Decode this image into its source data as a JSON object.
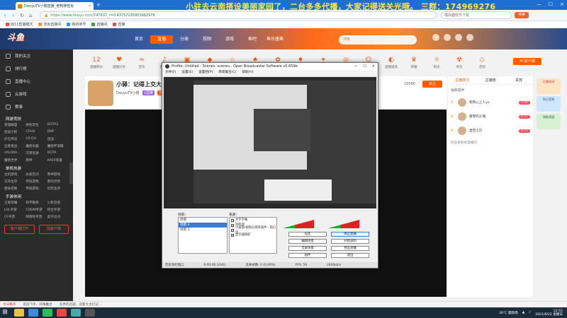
{
  "browser": {
    "tab_title": "DouyuTV小楼直播_老鸭神性玩",
    "marquee": "小驻去云南搭设美丽家园了，二台多多代播，大家记得送关光哦。  三群：174969276",
    "url_prefix": "https://www.douyu.com",
    "url_rest": "/747637_r=0.43757295803982976",
    "search_placeholder": "模拟器软件下载",
    "search_button": "搜索",
    "bookmarks": [
      "双11直播模式",
      "流出直播间",
      "我的账号",
      "直播间",
      "直播"
    ]
  },
  "site": {
    "logo": "斗鱼",
    "nav": [
      "首页",
      "直播",
      "分类",
      "视频",
      "游戏",
      "鱼吧",
      "鱼乐盛典"
    ],
    "search_placeholder": "搜索",
    "pc_client": "PC客户端"
  },
  "sidebar": {
    "items": [
      "我的关注",
      "排行榜",
      "直播中心",
      "云游戏",
      "赛事"
    ],
    "sec_hot": "网游竞技",
    "hot_games": [
      "英雄联盟",
      "绝地求生",
      "DOTA2",
      "逆战小程",
      "CFHD",
      "DNF",
      "炉石传说",
      "CS:GO",
      "逆战",
      "全民枪战",
      "魔兽争霸",
      "魔兽怀旧服",
      "VALORA...",
      "守望先锋",
      "DOTA",
      "魔兽世界",
      "原神",
      "APEX英雄"
    ],
    "sec_mobile": "单机热游",
    "mobile_games": [
      "主机游戏",
      "永劫无间",
      "原神游戏",
      "方舟生存",
      "怀旧游戏",
      "我的世界",
      "使命召唤",
      "怀旧游戏",
      "饥荒生存"
    ],
    "sec_pc": "手游休闲",
    "pc_games": [
      "王者荣耀",
      "和平精英",
      "火影忍者",
      "LOL手游",
      "CODM手游",
      "综合手游",
      "CF手游",
      "阴阳师手游",
      "蛋仔派对"
    ],
    "btn_left": "客户端打开",
    "btn_right": "找客户端"
  },
  "categories": [
    {
      "icon": "12",
      "label": "直播积分"
    },
    {
      "icon": "♥",
      "label": "直播分享"
    },
    {
      "icon": "≈",
      "label": "音乐"
    },
    {
      "icon": "♪",
      "label": "音乐台"
    },
    {
      "icon": "▣",
      "label": "直播记录"
    },
    {
      "icon": "◆",
      "label": "星光"
    },
    {
      "icon": "☆",
      "label": "星光"
    },
    {
      "icon": "♠",
      "label": "猫咪"
    },
    {
      "icon": "✿",
      "label": "鲜花"
    },
    {
      "icon": "♦",
      "label": "钻石"
    },
    {
      "icon": "✦",
      "label": "星光"
    },
    {
      "icon": "◎",
      "label": "签到"
    },
    {
      "icon": "☺",
      "label": "表情"
    },
    {
      "icon": "◐",
      "label": "直播道具"
    },
    {
      "icon": "♛",
      "label": "荣耀"
    },
    {
      "icon": "☼",
      "label": "阳光"
    },
    {
      "icon": "☢",
      "label": "背包"
    },
    {
      "icon": "◇",
      "label": "活动"
    }
  ],
  "stream": {
    "title": "小驿：记得上交大天",
    "owner": "DouyuTV小楼",
    "badge": "V国舞",
    "tag": "直播中",
    "followers": "23586",
    "follow_btn": "关注"
  },
  "right_panel": {
    "tabs": [
      "主播排行",
      "主播榜",
      "贵宾"
    ],
    "heading": "独家陪伴",
    "ranks": [
      {
        "num": "1",
        "name": "和和心上人yo",
        "level": "lv.40"
      },
      {
        "num": "2",
        "name": "飘零的斗魂",
        "level": "lv.21"
      },
      {
        "num": "3",
        "name": "虚空之刃",
        "level": "lv.15"
      }
    ],
    "join_text": "欢迎来到本直播间",
    "widgets": [
      "主播房间",
      "你已签到",
      "领取奖励"
    ]
  },
  "obs": {
    "title": "Profile: Untitled - Scenes: scenes - Open Broadcaster Software v0.659b",
    "menu": [
      "文件(F)",
      "设置(S)",
      "设置档(P)",
      "场景集合(C)",
      "帮助(H)"
    ],
    "scenes_label": "场景：",
    "sources_label": "来源：",
    "scenes": [
      "场景",
      "场景 2",
      "场景 3"
    ],
    "sources": [
      "文字字幕",
      "游戏源",
      "小屏窗/视频分辨率插件 - 窗口化",
      "显示器捕获"
    ],
    "buttons": [
      "设定",
      "停止直播",
      "编辑场景",
      "开始录制",
      "全屏场景",
      "预览直播",
      "插件",
      "退出"
    ],
    "status_left": "无有效的窗口",
    "status_time": "0:00:00 (LIVE)",
    "status_drop": "丢失帧数: 0 (0.00%)",
    "status_fps": "FPS: 59",
    "status_kbps": "2400kb/s"
  },
  "notify": {
    "items": [
      "今日看点",
      "迎战飞手、同事推出",
      "业界的迅速，读看大主们记..."
    ]
  },
  "taskbar": {
    "weather": "26°C 雷阵雨",
    "time": "12:55",
    "date": "2021/8/22 星期日"
  }
}
